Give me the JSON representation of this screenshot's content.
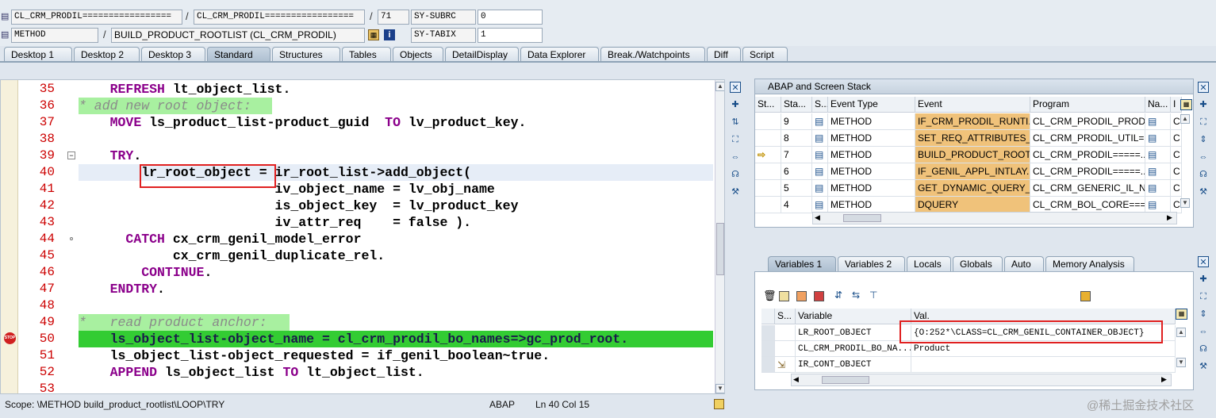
{
  "top_fields": {
    "row1": {
      "include": "CL_CRM_PRODIL=================",
      "program": "CL_CRM_PRODIL=================",
      "line": "71",
      "sy_label": "SY-SUBRC",
      "sy_value": "0"
    },
    "row2": {
      "type": "METHOD",
      "name": "BUILD_PRODUCT_ROOTLIST (CL_CRM_PRODIL)",
      "sy_label": "SY-TABIX",
      "sy_value": "1"
    },
    "separator": "/"
  },
  "tabs": [
    "Desktop 1",
    "Desktop 2",
    "Desktop 3",
    "Standard",
    "Structures",
    "Tables",
    "Objects",
    "DetailDisplay",
    "Data Explorer",
    "Break./Watchpoints",
    "Diff",
    "Script"
  ],
  "active_tab": "Standard",
  "editor": {
    "lines": [
      {
        "num": "35",
        "code": "    REFRESH lt_object_list."
      },
      {
        "num": "36",
        "code": "* add new root object:"
      },
      {
        "num": "37",
        "code": "    MOVE ls_product_list-product_guid  TO lv_product_key."
      },
      {
        "num": "38",
        "code": ""
      },
      {
        "num": "39",
        "code": "    TRY."
      },
      {
        "num": "40",
        "code": "        lr_root_object = ir_root_list->add_object("
      },
      {
        "num": "41",
        "code": "                         iv_object_name = lv_obj_name"
      },
      {
        "num": "42",
        "code": "                         is_object_key  = lv_product_key"
      },
      {
        "num": "43",
        "code": "                         iv_attr_req    = false )."
      },
      {
        "num": "44",
        "code": "      CATCH cx_crm_genil_model_error"
      },
      {
        "num": "45",
        "code": "            cx_crm_genil_duplicate_rel."
      },
      {
        "num": "46",
        "code": "        CONTINUE."
      },
      {
        "num": "47",
        "code": "    ENDTRY."
      },
      {
        "num": "48",
        "code": ""
      },
      {
        "num": "49",
        "code": "*   read product anchor:"
      },
      {
        "num": "50",
        "code": "    ls_object_list-object_name = cl_crm_prodil_bo_names=>gc_prod_root."
      },
      {
        "num": "51",
        "code": "    ls_object_list-object_requested = if_genil_boolean~true."
      },
      {
        "num": "52",
        "code": "    APPEND ls_object_list TO lt_object_list."
      },
      {
        "num": "53",
        "code": ""
      }
    ]
  },
  "status_bar": {
    "scope": "Scope: \\METHOD build_product_rootlist\\LOOP\\TRY",
    "lang": "ABAP",
    "position": "Ln  40 Col  15"
  },
  "stack_panel": {
    "title": "ABAP and Screen Stack",
    "headers": [
      "St...",
      "Sta...",
      "S...",
      "Event Type",
      "Event",
      "Program",
      "Na...",
      "I"
    ],
    "rows": [
      {
        "level": "9",
        "type": "METHOD",
        "event": "IF_CRM_PRODIL_RUNTI...",
        "program": "CL_CRM_PRODIL_PRODU...",
        "last": "C"
      },
      {
        "level": "8",
        "type": "METHOD",
        "event": "SET_REQ_ATTRIBUTES_...",
        "program": "CL_CRM_PRODIL_UTIL=...",
        "last": "C"
      },
      {
        "level": "7",
        "type": "METHOD",
        "event": "BUILD_PRODUCT_ROOT...",
        "program": "CL_CRM_PRODIL=====...",
        "last": "C"
      },
      {
        "level": "6",
        "type": "METHOD",
        "event": "IF_GENIL_APPL_INTLAY...",
        "program": "CL_CRM_PRODIL=====...",
        "last": "C"
      },
      {
        "level": "5",
        "type": "METHOD",
        "event": "GET_DYNAMIC_QUERY_...",
        "program": "CL_CRM_GENERIC_IL_NE...",
        "last": "C"
      },
      {
        "level": "4",
        "type": "METHOD",
        "event": "DQUERY",
        "program": "CL_CRM_BOL_CORE===...",
        "last": "C"
      }
    ]
  },
  "var_tabs": [
    "Variables 1",
    "Variables 2",
    "Locals",
    "Globals",
    "Auto",
    "Memory Analysis"
  ],
  "var_panel": {
    "headers": [
      "S...",
      "Variable",
      "Val."
    ],
    "rows": [
      {
        "variable": "LR_ROOT_OBJECT",
        "value": "{O:252*\\CLASS=CL_CRM_GENIL_CONTAINER_OBJECT}"
      },
      {
        "variable": "CL_CRM_PRODIL_BO_NA...",
        "value": "Product"
      },
      {
        "variable": "IR_CONT_OBJECT",
        "value": ""
      }
    ]
  },
  "watermark": "@稀土掘金技术社区",
  "colors": {
    "accent": "#e02020",
    "breakpoint_line": "#33cc33",
    "comment_bg": "#a8f0a0",
    "event_highlight": "#f0c27a"
  }
}
